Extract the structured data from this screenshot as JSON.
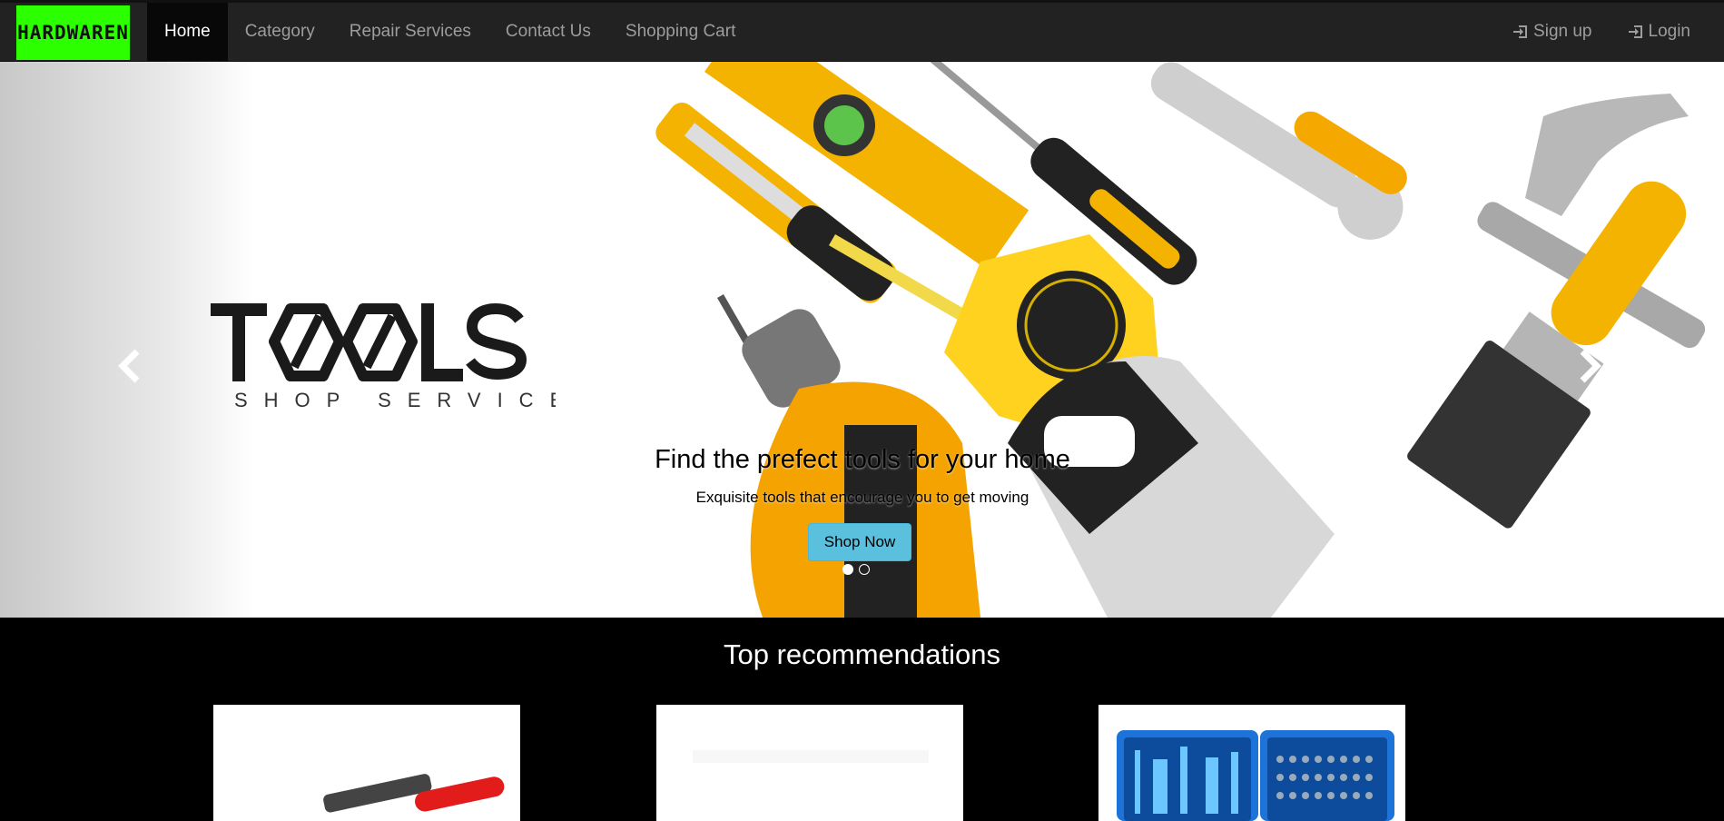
{
  "brand": {
    "logo_text": "HARDWAREN",
    "color": "#2bff00"
  },
  "nav": {
    "items": [
      {
        "label": "Home",
        "active": true
      },
      {
        "label": "Category"
      },
      {
        "label": "Repair Services"
      },
      {
        "label": "Contact Us"
      },
      {
        "label": "Shopping Cart"
      }
    ],
    "right": [
      {
        "label": "Sign up",
        "icon": "log-in-icon"
      },
      {
        "label": "Login",
        "icon": "log-in-icon"
      }
    ]
  },
  "carousel": {
    "logo": {
      "main": "TOOLS",
      "sub": "SHOP SERVICE"
    },
    "caption_title": "Find the prefect tools for your home",
    "caption_sub": "Exquisite tools that encourage you to get moving",
    "button": "Shop Now",
    "button_color": "#5bc0de",
    "slides": 2,
    "active_slide": 1
  },
  "recommendations": {
    "title": "Top recommendations",
    "products": [
      {
        "image": "wrench-image"
      },
      {
        "image": "blank-product-image"
      },
      {
        "image": "screwdriver-set-image"
      }
    ]
  }
}
